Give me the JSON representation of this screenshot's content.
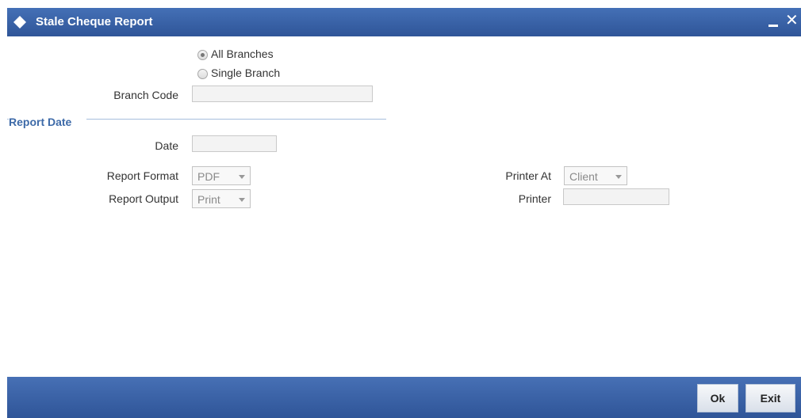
{
  "window": {
    "title": "Stale Cheque Report",
    "minimize_icon": "minimize-icon",
    "close_icon": "close-icon",
    "close_glyph": "✕",
    "brand_color": "#3a63a8"
  },
  "branch_selection": {
    "options": [
      {
        "label": "All Branches",
        "checked": true
      },
      {
        "label": "Single Branch",
        "checked": false
      }
    ],
    "branch_code_label": "Branch Code",
    "branch_code_value": ""
  },
  "report_date": {
    "legend": "Report Date",
    "date_label": "Date",
    "date_value": ""
  },
  "report_options": {
    "format_label": "Report Format",
    "format_value": "PDF",
    "output_label": "Report Output",
    "output_value": "Print",
    "printer_at_label": "Printer At",
    "printer_at_value": "Client",
    "printer_label": "Printer",
    "printer_value": ""
  },
  "footer": {
    "ok_label": "Ok",
    "exit_label": "Exit"
  }
}
